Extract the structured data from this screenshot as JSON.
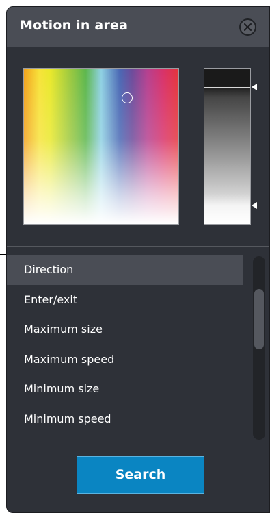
{
  "dialog": {
    "title": "Motion in area",
    "close_icon": "close-icon"
  },
  "color_picker": {
    "selected_color": "#4a68b4",
    "brightness_upper": 0.88,
    "brightness_lower": 0.12
  },
  "filter_list": {
    "items": [
      {
        "label": "Direction",
        "selected": true
      },
      {
        "label": "Enter/exit",
        "selected": false
      },
      {
        "label": "Maximum size",
        "selected": false
      },
      {
        "label": "Maximum speed",
        "selected": false
      },
      {
        "label": "Minimum size",
        "selected": false
      },
      {
        "label": "Minimum speed",
        "selected": false
      }
    ]
  },
  "actions": {
    "search_label": "Search"
  },
  "colors": {
    "panel_bg": "#2e3138",
    "header_bg": "#4a4d55",
    "accent": "#0a85c2"
  }
}
